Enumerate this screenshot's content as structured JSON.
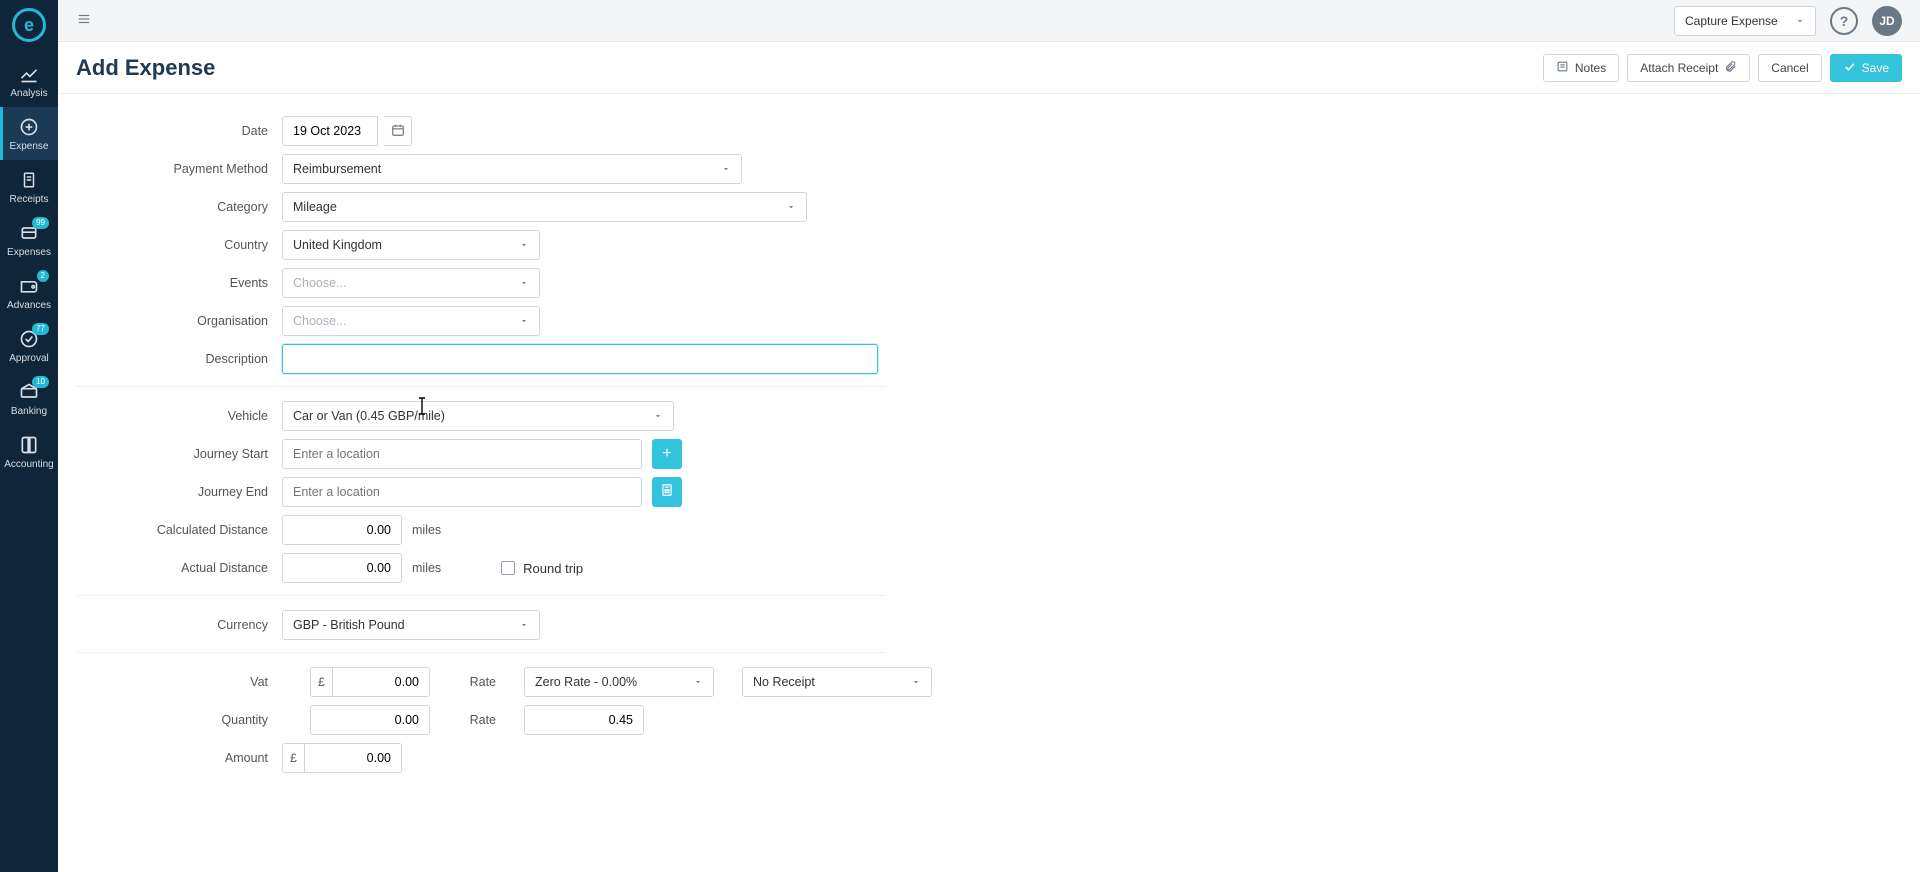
{
  "sidebar": {
    "items": [
      {
        "label": "Analysis"
      },
      {
        "label": "Expense"
      },
      {
        "label": "Receipts"
      },
      {
        "label": "Expenses",
        "badge": "99"
      },
      {
        "label": "Advances",
        "badge": "2"
      },
      {
        "label": "Approval",
        "badge": "77"
      },
      {
        "label": "Banking",
        "badge": "10"
      },
      {
        "label": "Accounting"
      }
    ]
  },
  "topbar": {
    "capture_label": "Capture Expense",
    "avatar": "JD"
  },
  "header": {
    "title": "Add Expense",
    "notes": "Notes",
    "attach": "Attach Receipt",
    "cancel": "Cancel",
    "save": "Save"
  },
  "labels": {
    "date": "Date",
    "payment_method": "Payment Method",
    "category": "Category",
    "country": "Country",
    "events": "Events",
    "organisation": "Organisation",
    "description": "Description",
    "vehicle": "Vehicle",
    "journey_start": "Journey Start",
    "journey_end": "Journey End",
    "calculated_distance": "Calculated Distance",
    "actual_distance": "Actual Distance",
    "round_trip": "Round trip",
    "currency": "Currency",
    "vat": "Vat",
    "rate": "Rate",
    "quantity": "Quantity",
    "amount": "Amount"
  },
  "values": {
    "date": "19 Oct 2023",
    "payment_method": "Reimbursement",
    "category": "Mileage",
    "country": "United Kingdom",
    "events": "Choose...",
    "organisation": "Choose...",
    "description": "",
    "vehicle": "Car or Van (0.45 GBP/mile)",
    "journey_start_ph": "Enter a location",
    "journey_end_ph": "Enter a location",
    "calculated_distance": "0.00",
    "actual_distance": "0.00",
    "distance_unit": "miles",
    "currency": "GBP - British Pound",
    "currency_symbol": "£",
    "vat": "0.00",
    "vat_rate": "Zero Rate - 0.00%",
    "receipt_status": "No Receipt",
    "quantity": "0.00",
    "price_rate": "0.45",
    "amount": "0.00"
  }
}
